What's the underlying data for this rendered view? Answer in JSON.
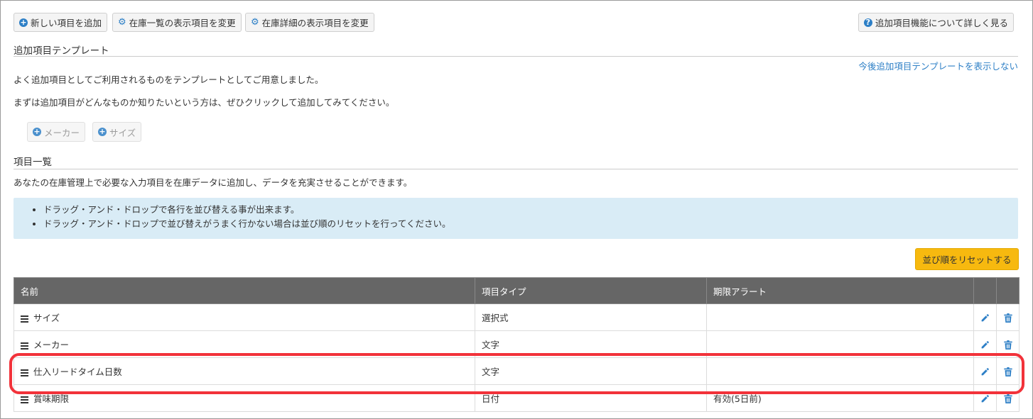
{
  "toolbar": {
    "add_item": "新しい項目を追加",
    "change_list_display": "在庫一覧の表示項目を変更",
    "change_detail_display": "在庫詳細の表示項目を変更",
    "help": "追加項目機能について詳しく見る"
  },
  "template_section": {
    "title": "追加項目テンプレート",
    "hide_link": "今後追加項目テンプレートを表示しない",
    "desc1": "よく追加項目としてご利用されるものをテンプレートとしてご用意しました。",
    "desc2": "まずは追加項目がどんなものか知りたいという方は、ぜひクリックして追加してみてください。",
    "buttons": [
      "メーカー",
      "サイズ"
    ]
  },
  "items_section": {
    "title": "項目一覧",
    "desc": "あなたの在庫管理上で必要な入力項目を在庫データに追加し、データを充実させることができます。",
    "info": [
      "ドラッグ・アンド・ドロップで各行を並び替える事が出来ます。",
      "ドラッグ・アンド・ドロップで並び替えがうまく行かない場合は並び順のリセットを行ってください。"
    ],
    "reset_button": "並び順をリセットする"
  },
  "table": {
    "headers": [
      "名前",
      "項目タイプ",
      "期限アラート"
    ],
    "rows": [
      {
        "name": "サイズ",
        "type": "選択式",
        "alert": ""
      },
      {
        "name": "メーカー",
        "type": "文字",
        "alert": ""
      },
      {
        "name": "仕入リードタイム日数",
        "type": "文字",
        "alert": ""
      },
      {
        "name": "賞味期限",
        "type": "日付",
        "alert": "有効(5日前)"
      }
    ]
  },
  "colors": {
    "accent": "#2d7fc6",
    "header_bg": "#666666",
    "info_bg": "#d9ecf6",
    "reset_bg": "#f7b90f",
    "highlight": "#f2323a"
  }
}
